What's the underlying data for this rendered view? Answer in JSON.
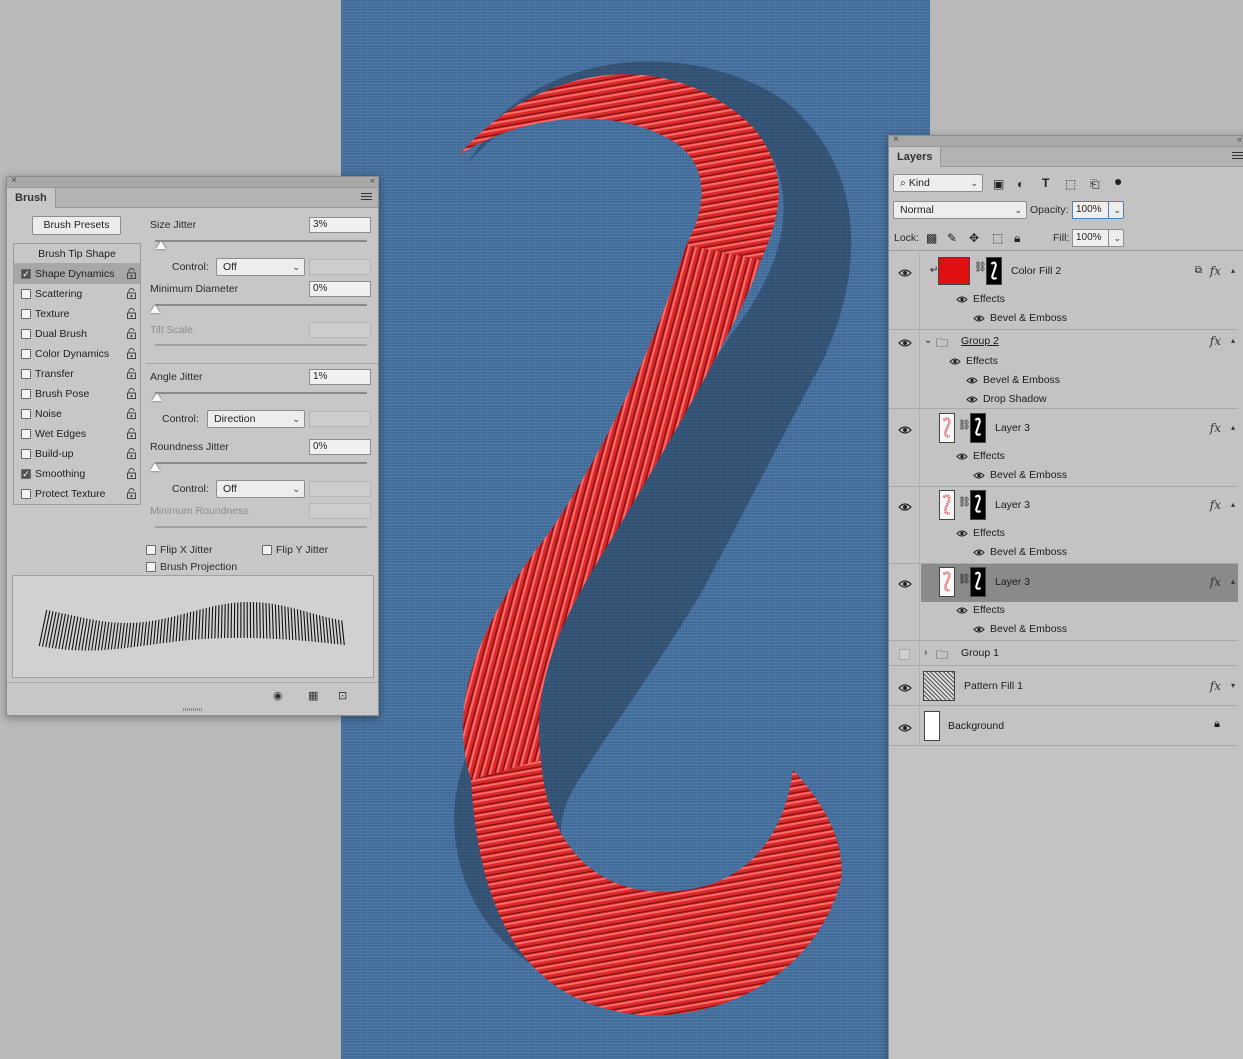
{
  "brush_panel": {
    "tab_label": "Brush",
    "presets_button": "Brush Presets",
    "tip_shape_label": "Brush Tip Shape",
    "options": [
      {
        "label": "Shape Dynamics",
        "checked": true,
        "selected": true
      },
      {
        "label": "Scattering",
        "checked": false
      },
      {
        "label": "Texture",
        "checked": false
      },
      {
        "label": "Dual Brush",
        "checked": false
      },
      {
        "label": "Color Dynamics",
        "checked": false
      },
      {
        "label": "Transfer",
        "checked": false
      },
      {
        "label": "Brush Pose",
        "checked": false
      },
      {
        "label": "Noise",
        "checked": false
      },
      {
        "label": "Wet Edges",
        "checked": false
      },
      {
        "label": "Build-up",
        "checked": false
      },
      {
        "label": "Smoothing",
        "checked": true
      },
      {
        "label": "Protect Texture",
        "checked": false
      }
    ],
    "size_jitter": {
      "label": "Size Jitter",
      "value": "3%",
      "level": 0.03
    },
    "control1": {
      "label": "Control:",
      "value": "Off"
    },
    "minimum_diameter": {
      "label": "Minimum Diameter",
      "value": "0%",
      "level": 0.0
    },
    "tilt_scale": {
      "label": "Tilt Scale"
    },
    "angle_jitter": {
      "label": "Angle Jitter",
      "value": "1%",
      "level": 0.01
    },
    "control2": {
      "label": "Control:",
      "value": "Direction"
    },
    "roundness_jitter": {
      "label": "Roundness Jitter",
      "value": "0%",
      "level": 0.0
    },
    "control3": {
      "label": "Control:",
      "value": "Off"
    },
    "minimum_roundness": {
      "label": "Minimum Roundness"
    },
    "flip_x": {
      "label": "Flip X Jitter",
      "checked": false
    },
    "flip_y": {
      "label": "Flip Y Jitter",
      "checked": false
    },
    "brush_projection": {
      "label": "Brush Projection",
      "checked": false
    }
  },
  "layers_panel": {
    "tab_label": "Layers",
    "filter_kind": "Kind",
    "blend_mode": "Normal",
    "opacity_label": "Opacity:",
    "opacity_value": "100%",
    "lock_label": "Lock:",
    "fill_label": "Fill:",
    "fill_value": "100%",
    "layers": [
      {
        "name": "Color Fill 2",
        "visible": true,
        "effects_label": "Effects",
        "effects": [
          "Bevel & Emboss"
        ]
      },
      {
        "name": "Group 2",
        "visible": true,
        "effects_label": "Effects",
        "effects": [
          "Bevel & Emboss",
          "Drop Shadow"
        ]
      },
      {
        "name": "Layer 3",
        "visible": true,
        "effects_label": "Effects",
        "effects": [
          "Bevel & Emboss"
        ]
      },
      {
        "name": "Layer 3",
        "visible": true,
        "effects_label": "Effects",
        "effects": [
          "Bevel & Emboss"
        ]
      },
      {
        "name": "Layer 3",
        "visible": true,
        "selected": true,
        "effects_label": "Effects",
        "effects": [
          "Bevel & Emboss"
        ]
      },
      {
        "name": "Group 1",
        "visible": false
      },
      {
        "name": "Pattern Fill 1",
        "visible": true
      },
      {
        "name": "Background",
        "visible": true
      }
    ]
  },
  "colors": {
    "canvas_blue": "#44709f",
    "stitch_red": "#e02828",
    "fill_red": "#e01010"
  }
}
